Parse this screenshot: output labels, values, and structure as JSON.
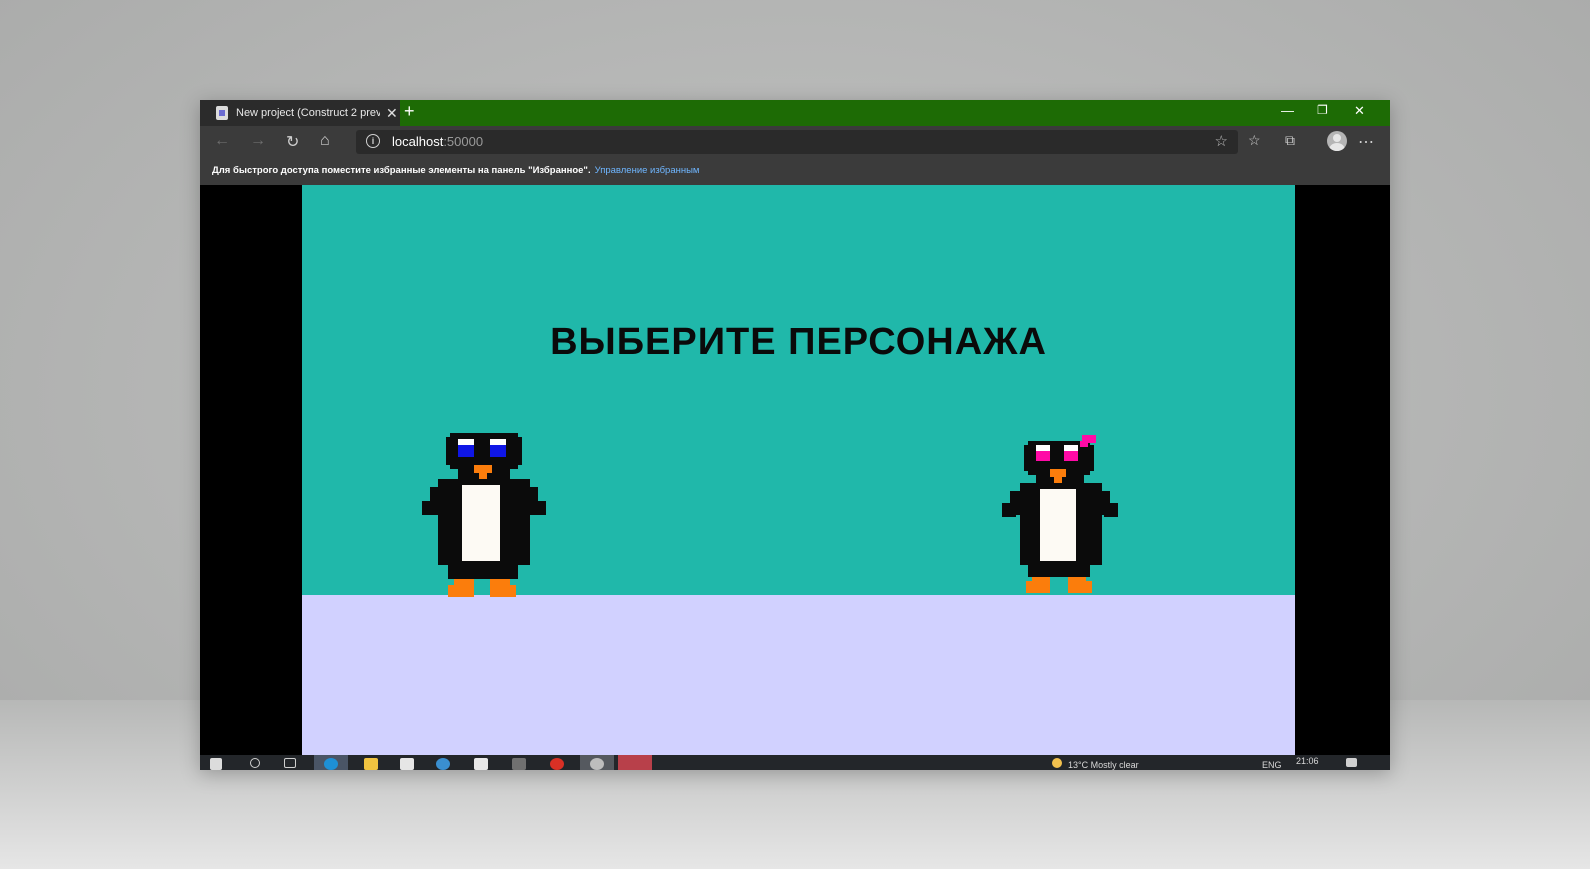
{
  "browser": {
    "tab_title": "New project (Construct 2 preview)",
    "url_host": "localhost",
    "url_port": ":50000",
    "favorites_bar_text": "Для быстрого доступа поместите избранные элементы на панель \"Избранное\".",
    "favorites_bar_link": "Управление избранным"
  },
  "game": {
    "title": "ВЫБЕРИТЕ ПЕРСОНАЖА",
    "characters": [
      {
        "name": "penguin-boy",
        "eye_color": "#0f16e6"
      },
      {
        "name": "penguin-girl",
        "eye_color": "#ff0aa6",
        "bow_color": "#ff0aa6"
      }
    ],
    "colors": {
      "sky": "#20b8aa",
      "ground": "#d1d1ff",
      "beak_feet": "#fb7d0c",
      "belly": "#fdfaf4"
    }
  },
  "taskbar": {
    "weather": "13°C  Mostly clear",
    "lang": "ENG",
    "time": "21:06"
  }
}
